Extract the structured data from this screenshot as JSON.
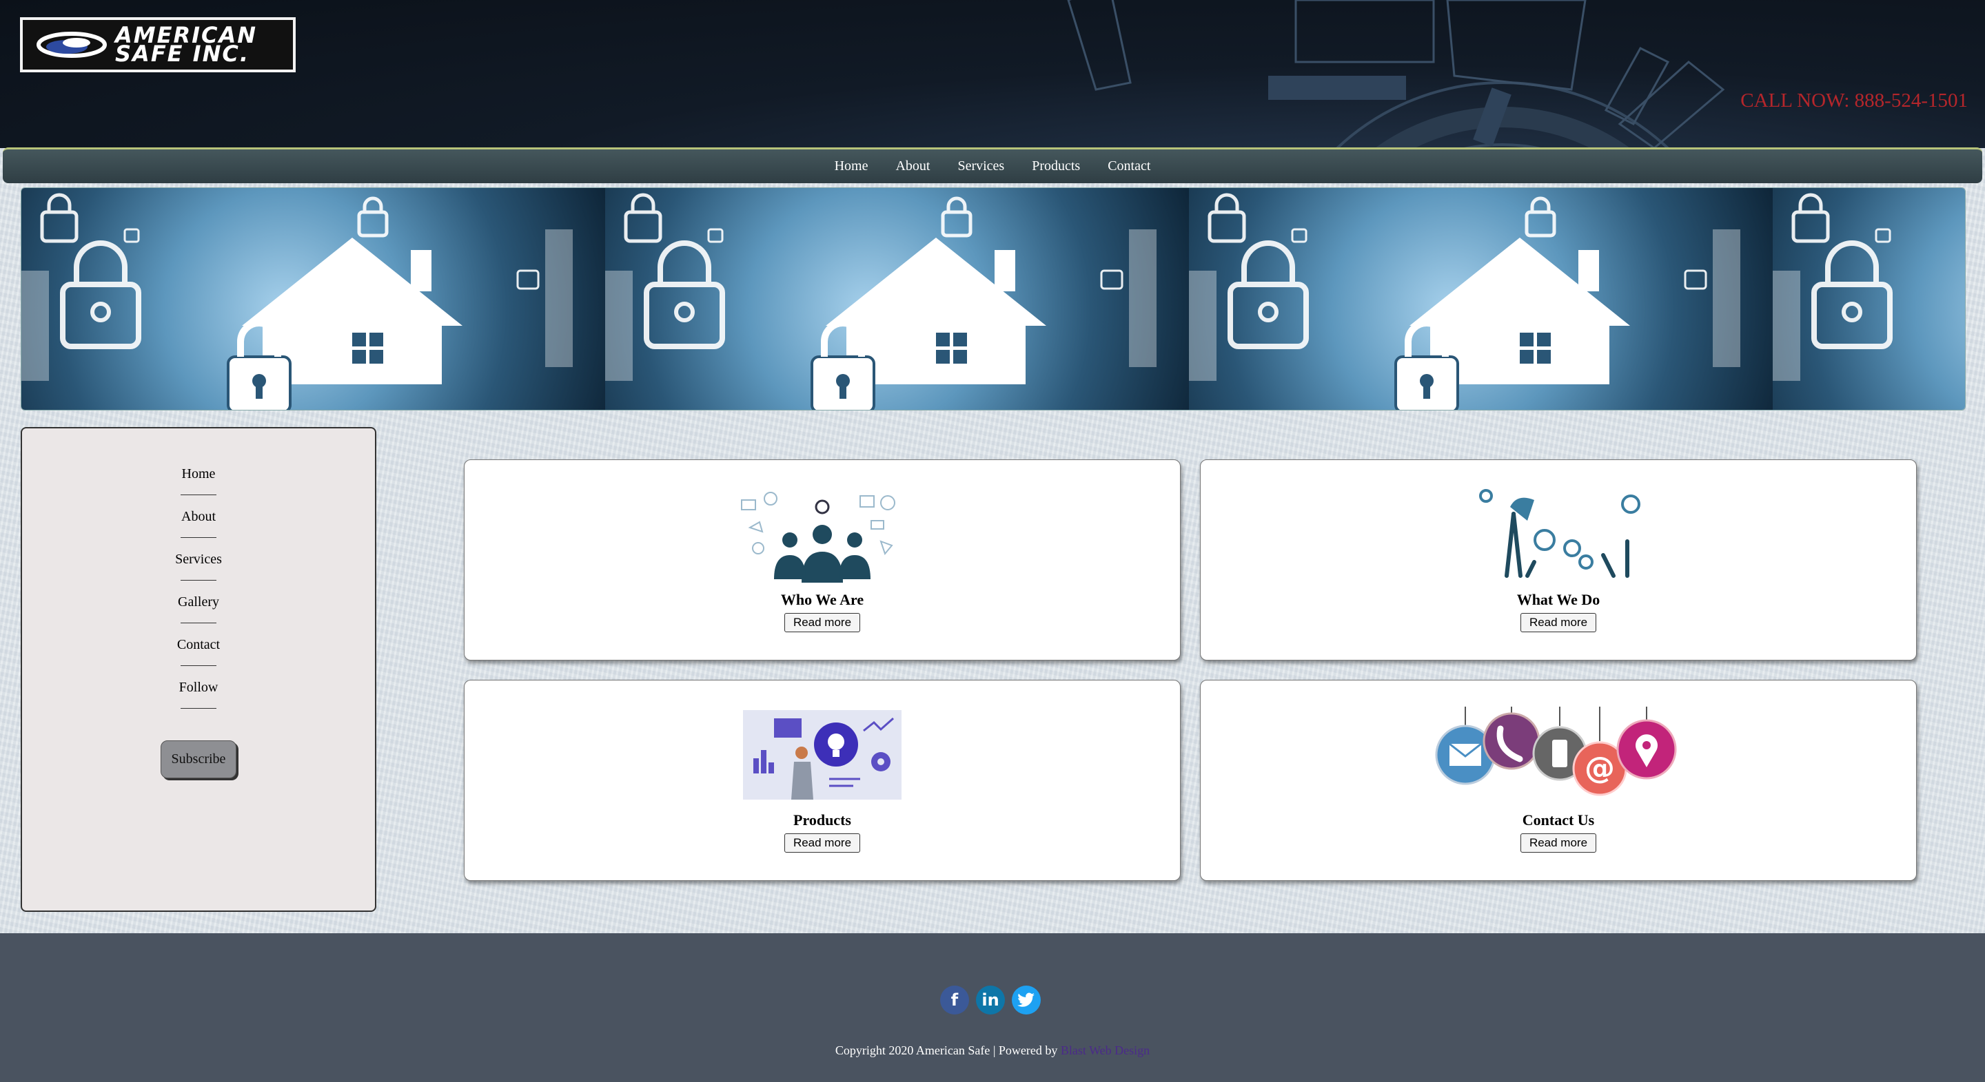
{
  "header": {
    "logo_line1": "AMERICAN",
    "logo_line2": "SAFE INC.",
    "call_now": "CALL NOW: 888-524-1501"
  },
  "nav": [
    "Home",
    "About",
    "Services",
    "Products",
    "Contact"
  ],
  "sidebar": {
    "items": [
      "Home",
      "About",
      "Services",
      "Gallery",
      "Contact",
      "Follow"
    ],
    "subscribe_label": "Subscribe"
  },
  "cards": [
    {
      "title": "Who We Are",
      "button": "Read more"
    },
    {
      "title": "What We Do",
      "button": "Read more"
    },
    {
      "title": "Products",
      "button": "Read more"
    },
    {
      "title": "Contact Us",
      "button": "Read more"
    }
  ],
  "footer": {
    "social": [
      {
        "name": "facebook-icon",
        "glyph": "f",
        "color": "#3b5998"
      },
      {
        "name": "linkedin-icon",
        "glyph": "in",
        "color": "#0e76a8"
      },
      {
        "name": "twitter-icon",
        "glyph": "t",
        "color": "#1da1f2"
      }
    ],
    "copyright": "Copyright 2020 American Safe | Powered by ",
    "powered_link": "Blast Web Design"
  },
  "colors": {
    "call_now": "#b5262b",
    "navbar": "#3a4a50",
    "footer": "#4a5360",
    "accent_link": "#4b2a8a"
  }
}
